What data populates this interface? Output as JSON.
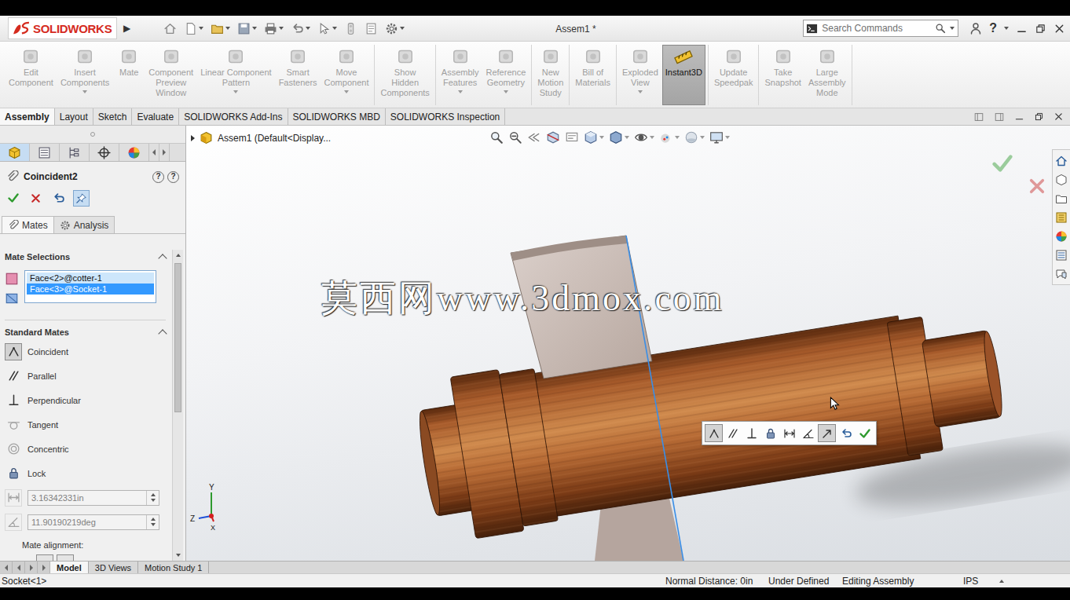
{
  "window": {
    "title": "Assem1 *"
  },
  "brand": {
    "name": "SOLIDWORKS",
    "menuArrow": "▶"
  },
  "search": {
    "placeholder": "Search Commands"
  },
  "help": "?",
  "ribbon": [
    {
      "buttons": [
        {
          "label": "Edit\nComponent",
          "enabled": false,
          "selected": false,
          "dropdown": false
        },
        {
          "label": "Insert\nComponents",
          "enabled": false,
          "selected": false,
          "dropdown": true
        },
        {
          "label": "Mate",
          "enabled": false,
          "selected": false,
          "dropdown": false
        },
        {
          "label": "Component\nPreview\nWindow",
          "enabled": false,
          "selected": false,
          "dropdown": false
        },
        {
          "label": "Linear Component\nPattern",
          "enabled": false,
          "selected": false,
          "dropdown": true
        },
        {
          "label": "Smart\nFasteners",
          "enabled": false,
          "selected": false,
          "dropdown": false
        },
        {
          "label": "Move\nComponent",
          "enabled": false,
          "selected": false,
          "dropdown": true
        }
      ]
    },
    {
      "buttons": [
        {
          "label": "Show\nHidden\nComponents",
          "enabled": false,
          "selected": false,
          "dropdown": false
        }
      ]
    },
    {
      "buttons": [
        {
          "label": "Assembly\nFeatures",
          "enabled": false,
          "selected": false,
          "dropdown": true
        },
        {
          "label": "Reference\nGeometry",
          "enabled": false,
          "selected": false,
          "dropdown": true
        }
      ]
    },
    {
      "buttons": [
        {
          "label": "New\nMotion\nStudy",
          "enabled": false,
          "selected": false,
          "dropdown": false
        }
      ]
    },
    {
      "buttons": [
        {
          "label": "Bill of\nMaterials",
          "enabled": false,
          "selected": false,
          "dropdown": false
        }
      ]
    },
    {
      "buttons": [
        {
          "label": "Exploded\nView",
          "enabled": false,
          "selected": false,
          "dropdown": true
        },
        {
          "label": "Instant3D",
          "enabled": true,
          "selected": true,
          "dropdown": false
        }
      ]
    },
    {
      "buttons": [
        {
          "label": "Update\nSpeedpak",
          "enabled": false,
          "selected": false,
          "dropdown": false
        }
      ]
    },
    {
      "buttons": [
        {
          "label": "Take\nSnapshot",
          "enabled": false,
          "selected": false,
          "dropdown": false
        },
        {
          "label": "Large\nAssembly\nMode",
          "enabled": false,
          "selected": false,
          "dropdown": false
        }
      ]
    }
  ],
  "commandTabs": [
    {
      "label": "Assembly",
      "selected": true
    },
    {
      "label": "Layout",
      "selected": false
    },
    {
      "label": "Sketch",
      "selected": false
    },
    {
      "label": "Evaluate",
      "selected": false
    },
    {
      "label": "SOLIDWORKS Add-Ins",
      "selected": false
    },
    {
      "label": "SOLIDWORKS MBD",
      "selected": false
    },
    {
      "label": "SOLIDWORKS Inspection",
      "selected": false
    }
  ],
  "propertyManager": {
    "panelTabs": [
      {
        "selected": true
      },
      {
        "selected": false
      },
      {
        "selected": false
      },
      {
        "selected": false
      },
      {
        "selected": false
      }
    ],
    "title": "Coincident2",
    "pinned": true,
    "tabs": [
      {
        "label": "Mates",
        "selected": true
      },
      {
        "label": "Analysis",
        "selected": false
      }
    ],
    "mateSelections": {
      "title": "Mate Selections",
      "expanded": true,
      "items": [
        {
          "text": "Face<2>@cotter-1",
          "selected": false
        },
        {
          "text": "Face<3>@Socket-1",
          "selected": true
        }
      ]
    },
    "standardMates": {
      "title": "Standard Mates",
      "expanded": true,
      "items": [
        {
          "kind": "option",
          "label": "Coincident",
          "value": "",
          "selected": true,
          "disabled": false
        },
        {
          "kind": "option",
          "label": "Parallel",
          "value": "",
          "selected": false,
          "disabled": false
        },
        {
          "kind": "option",
          "label": "Perpendicular",
          "value": "",
          "selected": false,
          "disabled": false
        },
        {
          "kind": "option",
          "label": "Tangent",
          "value": "",
          "selected": false,
          "disabled": true
        },
        {
          "kind": "option",
          "label": "Concentric",
          "value": "",
          "selected": false,
          "disabled": true
        },
        {
          "kind": "option",
          "label": "Lock",
          "value": "",
          "selected": false,
          "disabled": false
        },
        {
          "kind": "field",
          "label": "",
          "value": "3.16342331in",
          "selected": false,
          "disabled": true
        },
        {
          "kind": "field",
          "label": "",
          "value": "11.90190219deg",
          "selected": false,
          "disabled": true
        }
      ]
    },
    "mateAlignment": "Mate alignment:"
  },
  "viewport": {
    "tree": {
      "label": "Assem1 (Default<Display...",
      "expanded": false
    },
    "watermark": "莫西网www.3dmox.com",
    "triad": {
      "x": "X",
      "y": "Y",
      "z": "Z"
    },
    "contextToolbar": [
      {
        "selected": true
      },
      {
        "selected": false
      },
      {
        "selected": false
      },
      {
        "selected": false
      },
      {
        "selected": false
      },
      {
        "selected": false
      },
      {
        "selected": true
      },
      {
        "selected": false
      },
      {
        "selected": false
      }
    ]
  },
  "documentTabs": [
    {
      "label": "Model",
      "selected": true
    },
    {
      "label": "3D Views",
      "selected": false
    },
    {
      "label": "Motion Study 1",
      "selected": false
    }
  ],
  "statusBar": {
    "selection": "Socket<1>",
    "measure": "Normal Distance: 0in",
    "state": "Under Defined",
    "mode": "Editing Assembly",
    "units": "IPS"
  }
}
